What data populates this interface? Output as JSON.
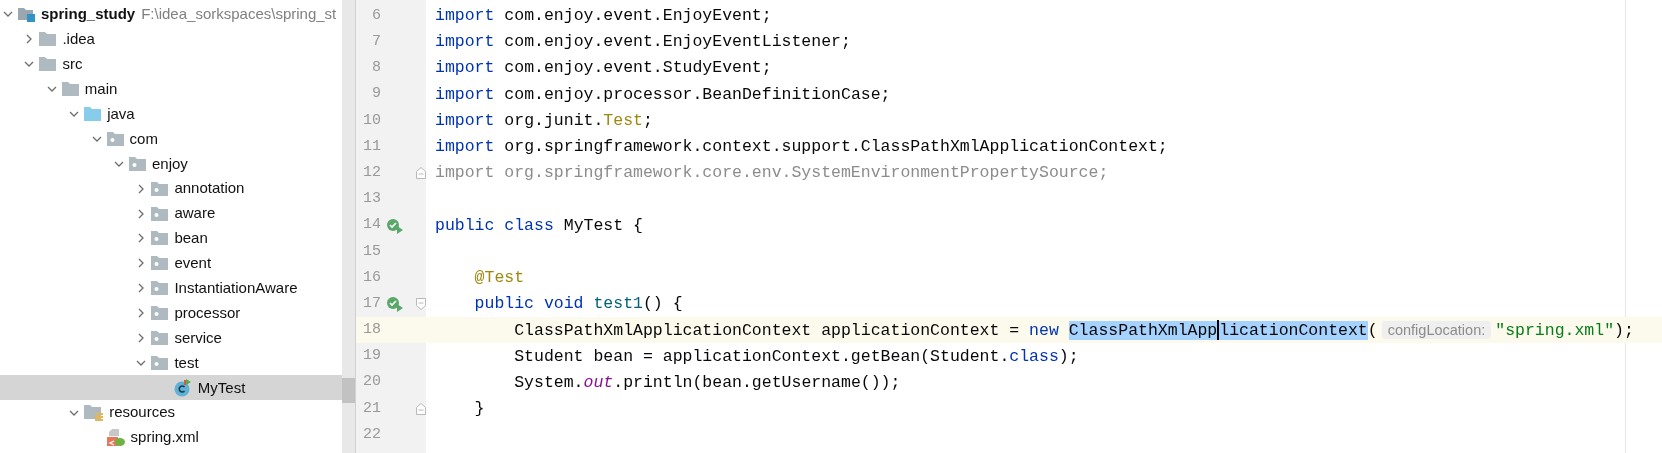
{
  "project_tree": {
    "root": {
      "name": "spring_study",
      "path": "F:\\idea_sorkspaces\\spring_st",
      "kind": "module",
      "expanded": true,
      "selected": false,
      "children": [
        {
          "name": ".idea",
          "kind": "folder",
          "expanded": false,
          "selected": false
        },
        {
          "name": "src",
          "kind": "folder",
          "expanded": true,
          "selected": false,
          "children": [
            {
              "name": "main",
              "kind": "folder",
              "expanded": true,
              "selected": false,
              "children": [
                {
                  "name": "java",
                  "kind": "source",
                  "expanded": true,
                  "selected": false,
                  "children": [
                    {
                      "name": "com",
                      "kind": "package",
                      "expanded": true,
                      "selected": false,
                      "children": [
                        {
                          "name": "enjoy",
                          "kind": "package",
                          "expanded": true,
                          "selected": false,
                          "children": [
                            {
                              "name": "annotation",
                              "kind": "package",
                              "expanded": false,
                              "selected": false
                            },
                            {
                              "name": "aware",
                              "kind": "package",
                              "expanded": false,
                              "selected": false
                            },
                            {
                              "name": "bean",
                              "kind": "package",
                              "expanded": false,
                              "selected": false
                            },
                            {
                              "name": "event",
                              "kind": "package",
                              "expanded": false,
                              "selected": false
                            },
                            {
                              "name": "InstantiationAware",
                              "kind": "package",
                              "expanded": false,
                              "selected": false
                            },
                            {
                              "name": "processor",
                              "kind": "package",
                              "expanded": false,
                              "selected": false
                            },
                            {
                              "name": "service",
                              "kind": "package",
                              "expanded": false,
                              "selected": false
                            },
                            {
                              "name": "test",
                              "kind": "package",
                              "expanded": true,
                              "selected": false,
                              "children": [
                                {
                                  "name": "MyTest",
                                  "kind": "class",
                                  "selected": true
                                }
                              ]
                            }
                          ]
                        }
                      ]
                    }
                  ]
                },
                {
                  "name": "resources",
                  "kind": "resources",
                  "expanded": true,
                  "selected": false,
                  "children": [
                    {
                      "name": "spring.xml",
                      "kind": "xml",
                      "selected": false
                    }
                  ]
                }
              ]
            }
          ]
        }
      ]
    }
  },
  "editor": {
    "lines": [
      {
        "number": "6",
        "run_icon": false,
        "current": false,
        "tokens": [
          {
            "text": "import",
            "kind": "keyword"
          },
          {
            "text": " com.enjoy.event.EnjoyEvent;",
            "kind": "plain"
          }
        ]
      },
      {
        "number": "7",
        "run_icon": false,
        "current": false,
        "tokens": [
          {
            "text": "import",
            "kind": "keyword"
          },
          {
            "text": " com.enjoy.event.EnjoyEventListener;",
            "kind": "plain"
          }
        ]
      },
      {
        "number": "8",
        "run_icon": false,
        "current": false,
        "tokens": [
          {
            "text": "import",
            "kind": "keyword"
          },
          {
            "text": " com.enjoy.event.StudyEvent;",
            "kind": "plain"
          }
        ]
      },
      {
        "number": "9",
        "run_icon": false,
        "current": false,
        "tokens": [
          {
            "text": "import",
            "kind": "keyword"
          },
          {
            "text": " com.enjoy.processor.BeanDefinitionCase;",
            "kind": "plain"
          }
        ]
      },
      {
        "number": "10",
        "run_icon": false,
        "current": false,
        "tokens": [
          {
            "text": "import",
            "kind": "keyword"
          },
          {
            "text": " org.junit.",
            "kind": "plain"
          },
          {
            "text": "Test",
            "kind": "annotation"
          },
          {
            "text": ";",
            "kind": "plain"
          }
        ]
      },
      {
        "number": "11",
        "run_icon": false,
        "current": false,
        "tokens": [
          {
            "text": "import",
            "kind": "keyword"
          },
          {
            "text": " org.springframework.context.support.ClassPathXmlApplicationContext;",
            "kind": "plain"
          }
        ]
      },
      {
        "number": "12",
        "run_icon": false,
        "current": false,
        "fold": {
          "kind": "end"
        },
        "tokens": [
          {
            "text": "import org.springframework.core.env.SystemEnvironmentPropertySource;",
            "kind": "unused"
          }
        ]
      },
      {
        "number": "13",
        "run_icon": false,
        "current": false
      },
      {
        "number": "14",
        "run_icon": true,
        "current": false,
        "tokens": [
          {
            "text": "public class",
            "kind": "keyword"
          },
          {
            "text": " MyTest {",
            "kind": "plain"
          }
        ]
      },
      {
        "number": "15",
        "run_icon": false,
        "current": false
      },
      {
        "number": "16",
        "run_icon": false,
        "current": false,
        "tokens": [
          {
            "text": "    @Test",
            "kind": "annotation"
          }
        ]
      },
      {
        "number": "17",
        "run_icon": true,
        "current": false,
        "fold": {
          "kind": "start"
        },
        "tokens": [
          {
            "text": "    public void ",
            "kind": "keyword"
          },
          {
            "text": "test1",
            "kind": "method"
          },
          {
            "text": "() {",
            "kind": "plain"
          }
        ]
      },
      {
        "number": "18",
        "run_icon": false,
        "current": true,
        "tokens": [
          {
            "text": "        ClassPathXmlApplicationContext applicationContext = ",
            "kind": "plain"
          },
          {
            "text": "new ",
            "kind": "keyword"
          },
          {
            "text": "ClassPathXmlApp",
            "kind": "selected"
          },
          {
            "kind": "caret"
          },
          {
            "text": "licationContext",
            "kind": "selected"
          },
          {
            "text": "(",
            "kind": "plain"
          },
          {
            "text": "configLocation:",
            "kind": "hint"
          },
          {
            "text": "\"spring.xml\"",
            "kind": "string"
          },
          {
            "text": ");",
            "kind": "plain"
          }
        ]
      },
      {
        "number": "19",
        "run_icon": false,
        "current": false,
        "tokens": [
          {
            "text": "        Student bean = applicationContext.getBean(Student.",
            "kind": "plain"
          },
          {
            "text": "class",
            "kind": "keyword"
          },
          {
            "text": ");",
            "kind": "plain"
          }
        ]
      },
      {
        "number": "20",
        "run_icon": false,
        "current": false,
        "tokens": [
          {
            "text": "        System.",
            "kind": "plain"
          },
          {
            "text": "out",
            "kind": "static"
          },
          {
            "text": ".println(bean.getUsername());",
            "kind": "plain"
          }
        ]
      },
      {
        "number": "21",
        "run_icon": false,
        "current": false,
        "fold": {
          "kind": "end"
        },
        "tokens": [
          {
            "text": "    }",
            "kind": "plain"
          }
        ]
      },
      {
        "number": "22",
        "run_icon": false,
        "current": false
      }
    ]
  }
}
